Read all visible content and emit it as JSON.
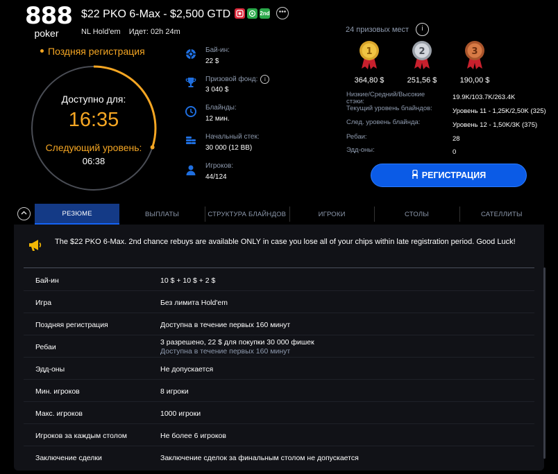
{
  "brand": {
    "logo_number": "888",
    "logo_word": "poker"
  },
  "header": {
    "title": "$22 PKO 6-Max - $2,500 GTD",
    "badges": [
      "PKO",
      "♣",
      "2nd"
    ],
    "game": "NL Hold'em",
    "running": "Идет: 02h 24m"
  },
  "late_registration": {
    "label": "Поздняя регистрация",
    "available_for_label": "Доступно для:",
    "available_time": "16:35",
    "next_level_label": "Следующий уровень:",
    "next_level_time": "06:38",
    "progress_fraction": 0.3
  },
  "info": {
    "buyin_label": "Бай-ин:",
    "buyin_value": "22 $",
    "prize_label": "Призовой фонд:",
    "prize_value": "3 040 $",
    "blinds_label": "Блайнды:",
    "blinds_value": "12 мин.",
    "stack_label": "Начальный стек:",
    "stack_value": "30 000 (12 BB)",
    "players_label": "Игроков:",
    "players_value": "44/124"
  },
  "prizes": {
    "places_label": "24 призовых мест",
    "first": "364,80 $",
    "second": "251,56 $",
    "third": "190,00 $"
  },
  "stats": {
    "stacks_label": "Низкие/Средний/Высокие стэки:",
    "stacks_value": "19.9K/103.7K/263.4K",
    "current_level_label": "Текущий уровень блайндов:",
    "current_level_value": "Уровень 11 - 1,25K/2,50K (325)",
    "next_level_label": "След. уровень блайнда:",
    "next_level_value": "Уровень 12 - 1,50K/3K (375)",
    "rebuys_label": "Ребаи:",
    "rebuys_value": "28",
    "addons_label": "Эдд-оны:",
    "addons_value": "0"
  },
  "register_button": "РЕГИСТРАЦИЯ",
  "tabs": [
    "РЕЗЮМЕ",
    "ВЫПЛАТЫ",
    "СТРУКТУРА БЛАЙНДОВ",
    "ИГРОКИ",
    "СТОЛЫ",
    "САТЕЛЛИТЫ"
  ],
  "notice": "The $22 PKO 6-Max. 2nd chance rebuys are available ONLY in case you lose all of your chips within late registration period. Good Luck!",
  "summary": [
    {
      "label": "Бай-ин",
      "value": "10 $ + 10 $ + 2 $"
    },
    {
      "label": "Игра",
      "value": "Без лимита Hold'em"
    },
    {
      "label": "Поздняя регистрация",
      "value": "Доступна в течение первых 160 минут"
    },
    {
      "label": "Ребаи",
      "value": "3 разрешено, 22 $ для покупки 30 000 фишек",
      "sub": "Доступна в течение первых 160 минут"
    },
    {
      "label": "Эдд-оны",
      "value": "Не допускается"
    },
    {
      "label": "Мин. игроков",
      "value": "8 игроки"
    },
    {
      "label": "Макс. игроков",
      "value": "1000 игроки"
    },
    {
      "label": "Игроков за каждым столом",
      "value": "Не более 6 игроков"
    },
    {
      "label": "Заключение сделки",
      "value": "Заключение сделок за финальным столом не допускается"
    }
  ],
  "colors": {
    "accent_orange": "#f5a623",
    "button_blue": "#0b5be6",
    "tab_active": "#143a86",
    "muted_text": "#8e9aae"
  }
}
